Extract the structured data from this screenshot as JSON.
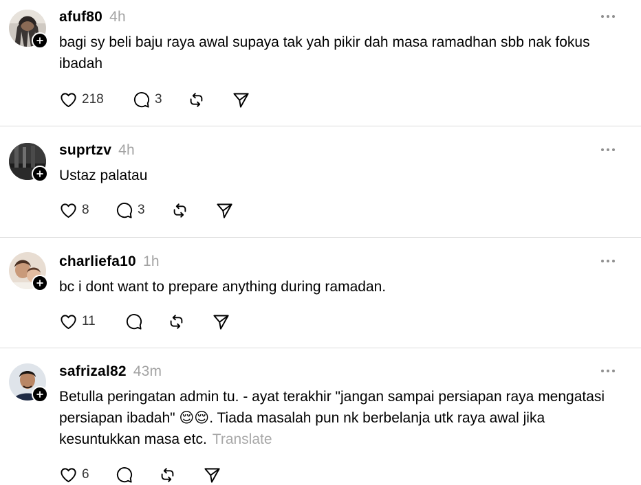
{
  "posts": [
    {
      "username": "afuf80",
      "time": "4h",
      "text": "bagi sy beli baju raya awal supaya tak yah pikir dah masa ramadhan sbb nak fokus ibadah",
      "likes": "218",
      "replies": "3",
      "translate": ""
    },
    {
      "username": "suprtzv",
      "time": "4h",
      "text": "Ustaz palatau",
      "likes": "8",
      "replies": "3",
      "translate": ""
    },
    {
      "username": "charliefa10",
      "time": "1h",
      "text": "bc i dont want to prepare anything during ramadan.",
      "likes": "11",
      "replies": "",
      "translate": ""
    },
    {
      "username": "safrizal82",
      "time": "43m",
      "text": "Betulla peringatan admin tu. - ayat terakhir \"jangan sampai persiapan raya mengatasi persiapan ibadah\" 😌😌. Tiada masalah pun nk berbelanja utk raya awal jika kesuntukkan masa etc.",
      "likes": "6",
      "replies": "",
      "translate": "Translate"
    }
  ],
  "icons": {
    "like": "heart-icon",
    "reply": "speech-bubble-icon",
    "repost": "repost-icon",
    "share": "send-icon",
    "more": "more-icon",
    "follow": "plus-icon"
  },
  "colors": {
    "text": "#000000",
    "muted": "#a3a3a3",
    "divider": "#dcdcdc"
  }
}
